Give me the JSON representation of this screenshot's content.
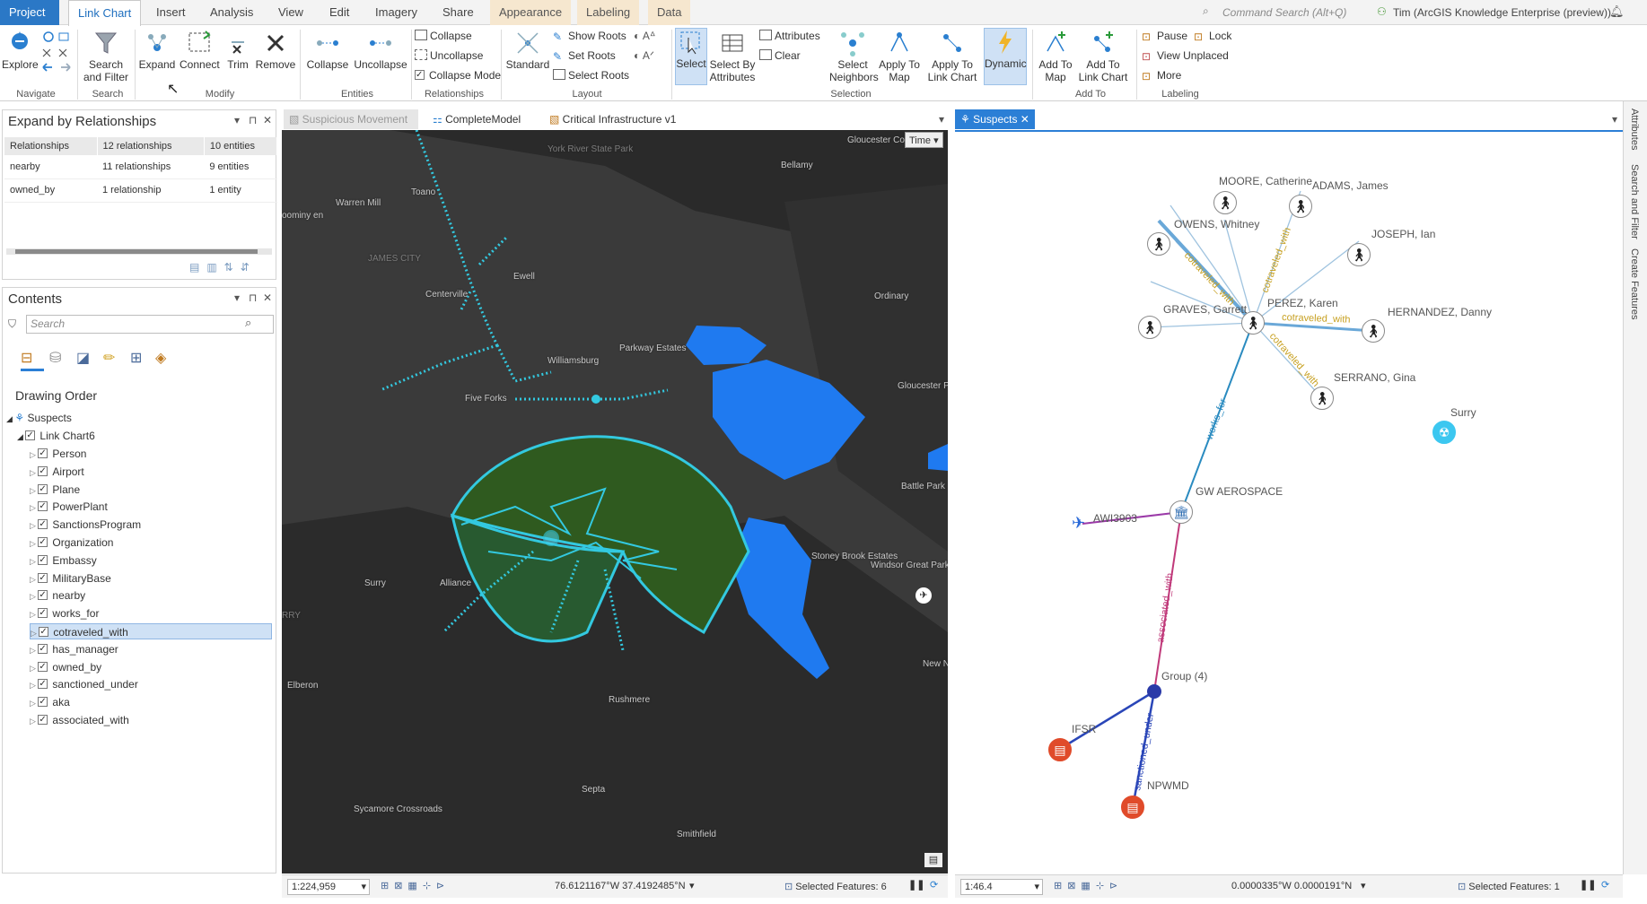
{
  "ribbon_tabs": [
    "Project",
    "Link Chart",
    "Insert",
    "Analysis",
    "View",
    "Edit",
    "Imagery",
    "Share",
    "Appearance",
    "Labeling",
    "Data"
  ],
  "command_search": "Command Search (Alt+Q)",
  "user": "Tim (ArcGIS Knowledge Enterprise (preview))",
  "ribbon": {
    "explore": "Explore",
    "search_filter": "Search and Filter",
    "expand": "Expand",
    "connect": "Connect",
    "trim": "Trim",
    "remove": "Remove",
    "collapse_big": "Collapse",
    "uncollapse_big": "Uncollapse",
    "collapse_small": "Collapse",
    "uncollapse_small": "Uncollapse",
    "collapse_mode": "Collapse Mode",
    "standard": "Standard",
    "show_roots": "Show Roots",
    "set_roots": "Set Roots",
    "select_roots": "Select Roots",
    "select": "Select",
    "select_by_attributes": "Select By Attributes",
    "attributes": "Attributes",
    "clear": "Clear",
    "select_neighbors": "Select Neighbors",
    "apply_to_map": "Apply To Map",
    "apply_to_link_chart": "Apply To Link Chart",
    "dynamic": "Dynamic",
    "add_to_map": "Add To Map",
    "add_to_link_chart": "Add To Link Chart",
    "pause": "Pause",
    "lock": "Lock",
    "view_unplaced": "View Unplaced",
    "more": "More",
    "groups": [
      "Navigate",
      "Search",
      "Modify",
      "Entities",
      "Relationships",
      "Layout",
      "Selection",
      "Add To",
      "Labeling"
    ]
  },
  "expand_pane": {
    "title": "Expand by Relationships",
    "headers": [
      "Relationships",
      "12 relationships",
      "10 entities"
    ],
    "rows": [
      {
        "name": "nearby",
        "rels": "11 relationships",
        "ents": "9 entities"
      },
      {
        "name": "owned_by",
        "rels": "1 relationship",
        "ents": "1 entity"
      }
    ]
  },
  "contents": {
    "title": "Contents",
    "search_placeholder": "Search",
    "drawing_order": "Drawing Order",
    "root": "Suspects",
    "chart": "Link Chart6",
    "layers": [
      "Person",
      "Airport",
      "Plane",
      "PowerPlant",
      "SanctionsProgram",
      "Organization",
      "Embassy",
      "MilitaryBase",
      "nearby",
      "works_for",
      "cotraveled_with",
      "has_manager",
      "owned_by",
      "sanctioned_under",
      "aka",
      "associated_with"
    ],
    "selected_layer": "cotraveled_with"
  },
  "view_tabs": {
    "map_tabs": [
      "Suspicious Movement",
      "CompleteModel",
      "Critical Infrastructure v1"
    ],
    "chart_tab": "Suspects"
  },
  "map": {
    "time_button": "Time",
    "labels": [
      "Gloucester Courthouse",
      "York River State Park",
      "Bellamy",
      "Warren Mill",
      "Toano",
      "Toano",
      "JAMES CITY",
      "Ewell",
      "Centerville",
      "Ordinary",
      "Parkway Estates",
      "Williamsburg",
      "Five Forks",
      "Gloucester Point",
      "Battle Park",
      "Stoney Brook Estates",
      "Windsor Great Park",
      "Surry",
      "Alliance",
      "Elberon",
      "Rushmere",
      "New Ne",
      "Septa",
      "Sycamore Crossroads",
      "Smithfield",
      "oominy en",
      "RRY"
    ],
    "scale": "1:224,959",
    "coords": "76.6121167°W 37.4192485°N",
    "selected": "Selected Features: 6"
  },
  "chart": {
    "nodes": [
      "MOORE, Catherine",
      "ADAMS, James",
      "OWENS, Whitney",
      "JOSEPH, Ian",
      "GRAVES, Garrett",
      "PEREZ, Karen",
      "HERNANDEZ, Danny",
      "SERRANO, Gina",
      "Surry",
      "GW AEROSPACE",
      "AWI3903",
      "Group (4)",
      "IFSR",
      "NPWMD"
    ],
    "edges": [
      "cotraveled_with",
      "cotraveled_with",
      "cotraveled_with",
      "cotraveled_with",
      "works_for",
      "associated_with",
      "sanctioned_under"
    ],
    "scale": "1:46.4",
    "coords": "0.0000335°W 0.0000191°N",
    "selected": "Selected Features: 1"
  },
  "rail": [
    "Attributes",
    "Search and Filter",
    "Create Features"
  ],
  "colors": {
    "accent": "#2b7fd6",
    "water": "#1f7af0",
    "buffer": "#2f5a1f",
    "tracks": "#33c9e0",
    "works_for": "#2a8bc0",
    "associated_with": "#c0397a",
    "sanctioned_under": "#2a46b8",
    "cotraveled_with": "#c7a020"
  }
}
